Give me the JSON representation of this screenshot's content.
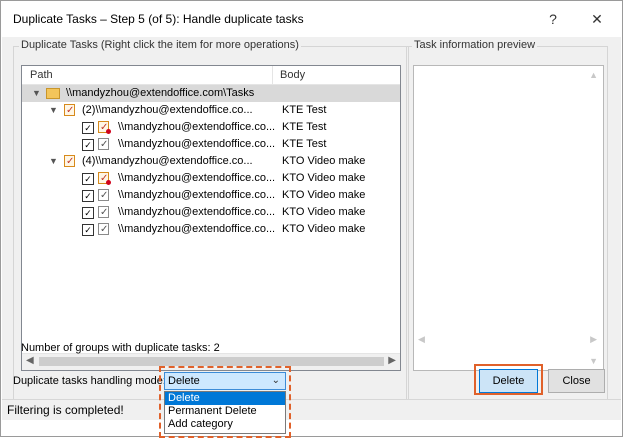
{
  "window": {
    "title": "Duplicate Tasks – Step 5 (of 5): Handle duplicate tasks",
    "help_label": "?",
    "close_label": "✕"
  },
  "left_group": {
    "title": "Duplicate Tasks (Right click the item for more operations)",
    "columns": [
      "Path",
      "Body"
    ],
    "root": {
      "path": "\\\\mandyzhou@extendoffice.com\\Tasks"
    },
    "groups": [
      {
        "path": "(2)\\\\mandyzhou@extendoffice.co...",
        "body": "KTE Test",
        "items": [
          {
            "path": "\\\\mandyzhou@extendoffice.co...",
            "body": "KTE Test",
            "checked": true,
            "icon": "task-overdue-icon"
          },
          {
            "path": "\\\\mandyzhou@extendoffice.co...",
            "body": "KTE Test",
            "checked": true,
            "icon": "task-icon"
          }
        ]
      },
      {
        "path": "(4)\\\\mandyzhou@extendoffice.co...",
        "body": "KTO Video make",
        "items": [
          {
            "path": "\\\\mandyzhou@extendoffice.co...",
            "body": "KTO Video make",
            "checked": true,
            "icon": "task-overdue-icon"
          },
          {
            "path": "\\\\mandyzhou@extendoffice.co...",
            "body": "KTO Video make",
            "checked": true,
            "icon": "task-icon"
          },
          {
            "path": "\\\\mandyzhou@extendoffice.co...",
            "body": "KTO Video make",
            "checked": true,
            "icon": "task-icon"
          },
          {
            "path": "\\\\mandyzhou@extendoffice.co...",
            "body": "KTO Video make",
            "checked": true,
            "icon": "task-icon"
          }
        ]
      }
    ],
    "group_count_text": "Number of groups with duplicate tasks: 2"
  },
  "right_group": {
    "title": "Task information preview"
  },
  "handling": {
    "label": "Duplicate tasks handling mode:",
    "selected": "Delete",
    "options": [
      "Delete",
      "Permanent Delete",
      "Add category"
    ]
  },
  "buttons": {
    "delete": "Delete",
    "close": "Close"
  },
  "status": {
    "text": "Filtering is completed!"
  },
  "colors": {
    "highlight": "#e0612a",
    "selected_option": "#0078d7"
  }
}
